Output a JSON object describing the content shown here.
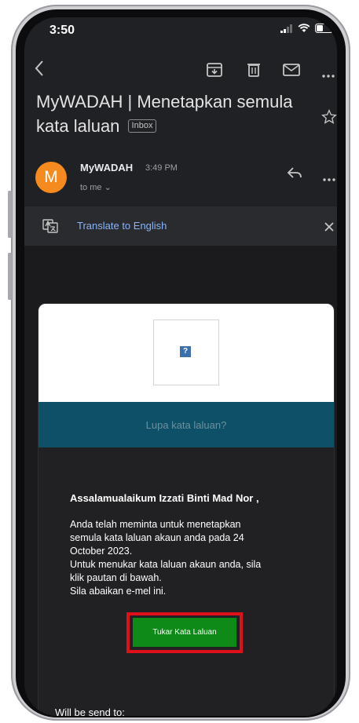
{
  "status": {
    "time": "3:50"
  },
  "toolbar": {
    "back_icon": "arrow-left-icon",
    "archive_icon": "archive-icon",
    "delete_icon": "trash-icon",
    "mail_icon": "mail-icon",
    "more_icon": "more-icon"
  },
  "email": {
    "subject": "MyWADAH | Menetapkan semula kata laluan",
    "label": "Inbox",
    "sender_initial": "M",
    "sender": "MyWADAH",
    "time": "3:49 PM",
    "recipient": "to me ⌄"
  },
  "translate": {
    "label": "Translate to English"
  },
  "card": {
    "image_placeholder": "?",
    "banner": "Lupa kata laluan?",
    "greeting": "Assalamualaikum Izzati Binti Mad Nor ,",
    "body_lines": [
      "Anda telah meminta untuk menetapkan",
      "semula kata laluan akaun anda pada 24",
      "October 2023.",
      "Untuk menukar kata laluan akaun anda, sila",
      "klik pautan di bawah.",
      "Sila abaikan e-mel ini."
    ],
    "button": "Tukar Kata Laluan",
    "footer": "Will be send to:"
  },
  "colors": {
    "avatar": "#f58a1f",
    "banner": "#0d5068",
    "button": "#0d8a17",
    "highlight": "#e0101a",
    "link": "#8ab4f8"
  }
}
